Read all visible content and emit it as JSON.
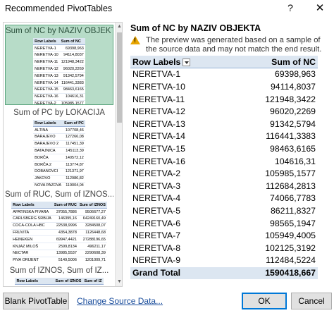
{
  "window": {
    "title": "Recommended PivotTables",
    "help_label": "?",
    "close_label": "✕"
  },
  "icons": {
    "help": "question-mark-icon",
    "close": "close-icon",
    "warning": "warning-triangle-icon",
    "filter": "filter-dropdown-icon"
  },
  "colors": {
    "selected_card_bg": "#b7dcc8",
    "header_fill": "#dce6f1",
    "link": "#1a4d9c",
    "warning": "#e8a500",
    "ok_border": "#0078d7"
  },
  "recommendations": [
    {
      "title": "Sum of NC by NAZIV OBJEKTA",
      "selected": true,
      "headers": [
        "Row Labels",
        "Sum of NC"
      ],
      "rows": [
        [
          "NERETVA-1",
          "69398,963"
        ],
        [
          "NERETVA-10",
          "94114,8037"
        ],
        [
          "NERETVA-11",
          "121948,3422"
        ],
        [
          "NERETVA-12",
          "96020,2269"
        ],
        [
          "NERETVA-13",
          "91342,5794"
        ],
        [
          "NERETVA-14",
          "116441,3383"
        ],
        [
          "NERETVA-15",
          "98463,6165"
        ],
        [
          "NERETVA-16",
          "104616,31"
        ],
        [
          "NERETVA-2",
          "105985,1577"
        ]
      ]
    },
    {
      "title": "Sum of PC by LOKACIJA",
      "selected": false,
      "headers": [
        "Row Labels",
        "Sum of PC"
      ],
      "rows": [
        [
          "ALTINA",
          "107708,46"
        ],
        [
          "BARAJEVO",
          "127266,08"
        ],
        [
          "BARAJEVO 2",
          "117451,39"
        ],
        [
          "BATAJNICA",
          "145113,39"
        ],
        [
          "BORČA",
          "140572,12"
        ],
        [
          "BORČA 2",
          "113774,87"
        ],
        [
          "DOBANOVCI",
          "121371,97"
        ],
        [
          "JAKOVO",
          "112986,82"
        ],
        [
          "NOVA PAZOVA",
          "119004,04"
        ]
      ]
    },
    {
      "title": "Sum of RUC, Sum of IZNOS...",
      "selected": false,
      "headers": [
        "Row Labels",
        "Sum of RUC",
        "Sum of IZNOS"
      ],
      "rows": [
        [
          "APATINSKA PIVARA",
          "37055,7886",
          "9506677,27"
        ],
        [
          "CARLSBERG SRBIJA",
          "146395,16",
          "64249160,49"
        ],
        [
          "COCA-COLA HBC",
          "22538,9996",
          "3284508,07"
        ],
        [
          "FRUVITA",
          "4354,3878",
          "1126448,68"
        ],
        [
          "HEINEKEN",
          "69947,4421",
          "27288196,65"
        ],
        [
          "KNJAZ MILOŠ",
          "2599,8134",
          "496211,17"
        ],
        [
          "NECTAR",
          "13985,5537",
          "2290608,39"
        ],
        [
          "PIVA ORIJENT",
          "5149,5006",
          "1201009,71"
        ],
        [
          "SUNOKO",
          "5316,8006",
          "1067117,60"
        ]
      ]
    },
    {
      "title": "Sum of IZNOS, Sum of IZ...",
      "selected": false,
      "headers": [
        "Row Labels",
        "Sum of IZNOS",
        "Sum of IZ"
      ],
      "rows": [
        [
          "APATINSKA PIVARA",
          "9506677,27",
          "13790"
        ]
      ]
    }
  ],
  "preview": {
    "title": "Sum of NC by NAZIV OBJEKTA",
    "warning": "The preview was generated based on a sample of the source data and may not match the end result.",
    "headers": [
      "Row Labels",
      "Sum of NC"
    ],
    "rows": [
      [
        "NERETVA-1",
        "69398,963"
      ],
      [
        "NERETVA-10",
        "94114,8037"
      ],
      [
        "NERETVA-11",
        "121948,3422"
      ],
      [
        "NERETVA-12",
        "96020,2269"
      ],
      [
        "NERETVA-13",
        "91342,5794"
      ],
      [
        "NERETVA-14",
        "116441,3383"
      ],
      [
        "NERETVA-15",
        "98463,6165"
      ],
      [
        "NERETVA-16",
        "104616,31"
      ],
      [
        "NERETVA-2",
        "105985,1577"
      ],
      [
        "NERETVA-3",
        "112684,2813"
      ],
      [
        "NERETVA-4",
        "74066,7783"
      ],
      [
        "NERETVA-5",
        "86211,8327"
      ],
      [
        "NERETVA-6",
        "98565,1947"
      ],
      [
        "NERETVA-7",
        "105949,4005"
      ],
      [
        "NERETVA-8",
        "102125,3192"
      ],
      [
        "NERETVA-9",
        "112484,5224"
      ]
    ],
    "total": [
      "Grand Total",
      "1590418,667"
    ]
  },
  "buttons": {
    "blank": "Blank PivotTable",
    "change_source": "Change Source Data...",
    "ok": "OK",
    "cancel": "Cancel"
  }
}
